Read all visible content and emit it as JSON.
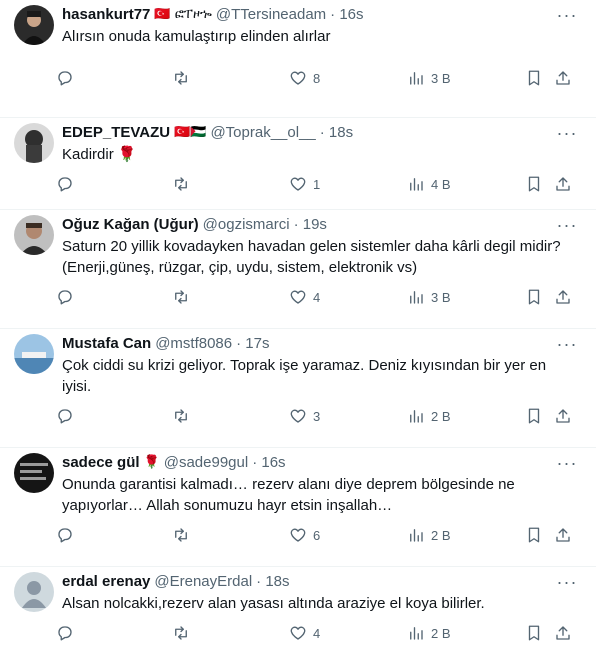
{
  "tweets": [
    {
      "name": "hasankurt77",
      "badge": "🇹🇷 ፎፐዞኈ",
      "handle": "@TTersineadam",
      "time": "· 16s",
      "text": "Alırsın onuda kamulaştırıp elinden alırlar",
      "reply": "",
      "retweet": "",
      "likes": "8",
      "views": "3 B",
      "avatar_color": "#2d2d2d"
    },
    {
      "name": "EDEP_TEVAZU",
      "badge": "🇹🇷🇵🇸",
      "handle": "@Toprak__ol__",
      "time": "· 18s",
      "text": "Kadirdir 🌹",
      "reply": "",
      "retweet": "",
      "likes": "1",
      "views": "4 B",
      "avatar_color": "#3a3a3a"
    },
    {
      "name": "Oğuz Kağan (Uğur)",
      "badge": "",
      "handle": "@ogzismarci",
      "time": "· 19s",
      "text": "Saturn 20 yillik kovadayken havadan gelen sistemler daha kârli degil midir? (Enerji,güneş, rüzgar, çip, uydu, sistem, elektronik vs)",
      "reply": "",
      "retweet": "",
      "likes": "4",
      "views": "3 B",
      "avatar_color": "#8a7a6a"
    },
    {
      "name": "Mustafa Can",
      "badge": "",
      "handle": "@mstf8086",
      "time": "· 17s",
      "text": "Çok ciddi su krizi geliyor. Toprak işe yaramaz. Deniz kıyısından bir yer en iyisi.",
      "reply": "",
      "retweet": "",
      "likes": "3",
      "views": "2 B",
      "avatar_color": "#6fa8d6"
    },
    {
      "name": "sadece gül",
      "badge": "🌹",
      "handle": "@sade99gul",
      "time": "· 16s",
      "text": "Onunda garantisi kalmadı… rezerv alanı diye deprem bölgesinde ne yapıyorlar… Allah sonumuzu hayr etsin inşallah…",
      "reply": "",
      "retweet": "",
      "likes": "6",
      "views": "2 B",
      "avatar_color": "#1b1b1b"
    },
    {
      "name": "erdal erenay",
      "badge": "",
      "handle": "@ErenayErdal",
      "time": "· 18s",
      "text": "Alsan nolcakki,rezerv alan yasası altında araziye el koya bilirler.",
      "reply": "",
      "retweet": "",
      "likes": "4",
      "views": "2 B",
      "avatar_color": "#cfd9de"
    }
  ],
  "more_glyph": "···",
  "colors": {
    "text": "#0f1419",
    "muted": "#536471",
    "divider": "#eff3f4"
  }
}
